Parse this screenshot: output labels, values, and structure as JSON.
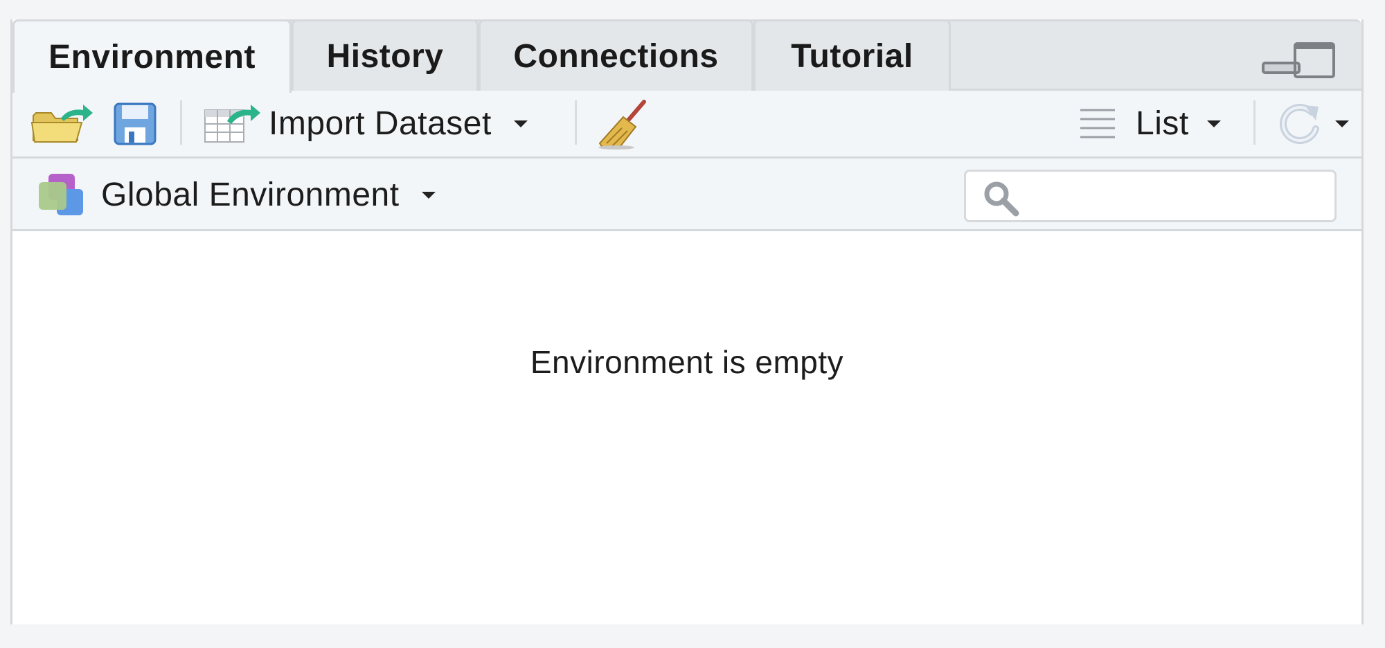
{
  "tabs": [
    {
      "label": "Environment",
      "active": true
    },
    {
      "label": "History",
      "active": false
    },
    {
      "label": "Connections",
      "active": false
    },
    {
      "label": "Tutorial",
      "active": false
    }
  ],
  "toolbar": {
    "load_icon": "open-folder-icon",
    "save_icon": "save-disk-icon",
    "import_label": "Import Dataset",
    "clear_icon": "broom-icon",
    "view_label": "List",
    "refresh_icon": "refresh-icon"
  },
  "environment": {
    "selector_label": "Global Environment",
    "search_placeholder": "",
    "search_value": ""
  },
  "content": {
    "empty_message": "Environment is empty"
  },
  "colors": {
    "accent_green": "#2bb38a",
    "pane_border": "#d6d9dc",
    "toolbar_bg": "#f3f6f8"
  }
}
